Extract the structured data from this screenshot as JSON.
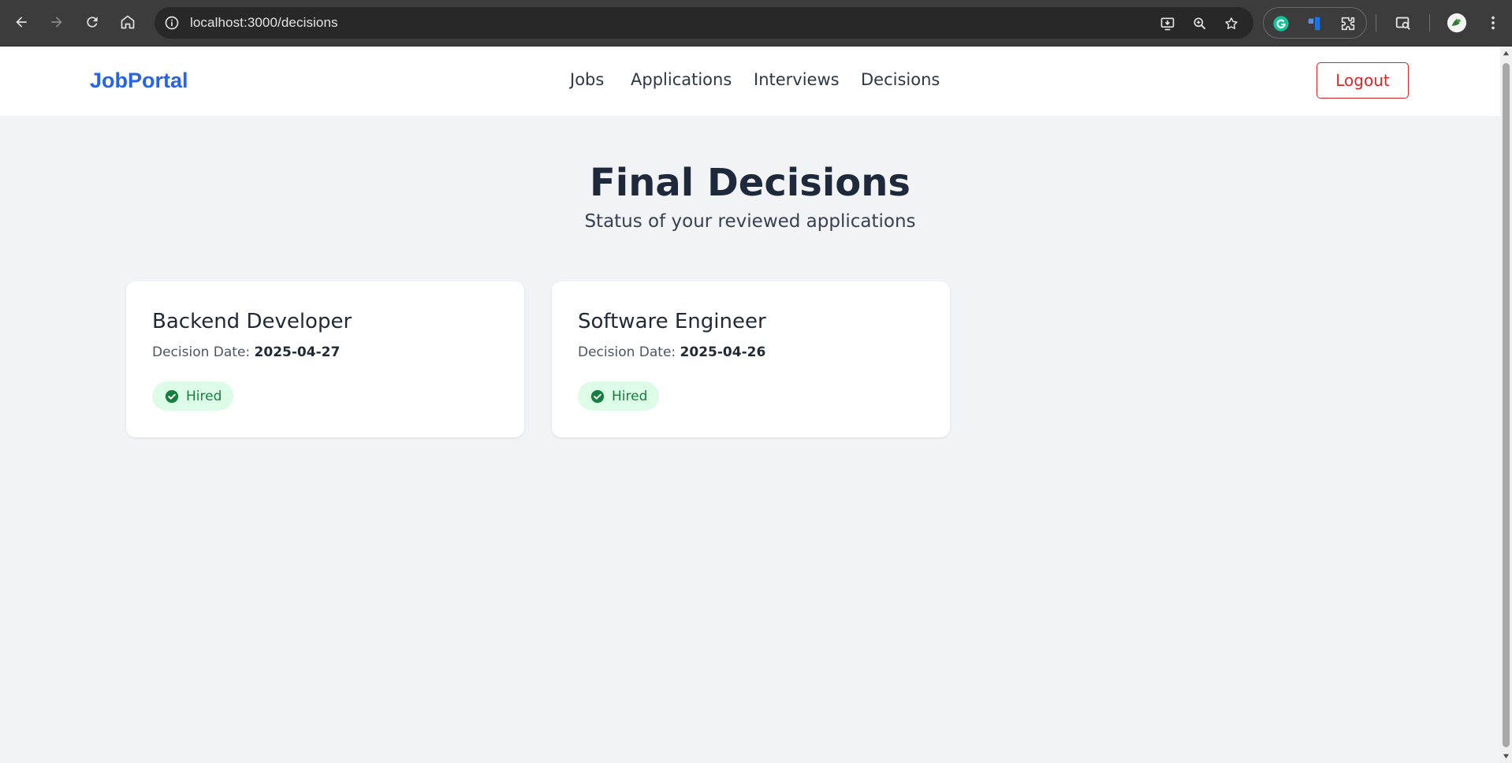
{
  "browser": {
    "url": "localhost:3000/decisions",
    "colors": {
      "chrome_bg": "#3c3c3c",
      "omnibox_bg": "#282828"
    }
  },
  "header": {
    "brand": "JobPortal",
    "nav": [
      "Jobs",
      "Applications",
      "Interviews",
      "Decisions"
    ],
    "logout_label": "Logout"
  },
  "main": {
    "title": "Final Decisions",
    "subtitle": "Status of your reviewed applications",
    "date_label": "Decision Date:",
    "cards": [
      {
        "job_title": "Backend Developer",
        "decision_date": "2025-04-27",
        "status": "Hired"
      },
      {
        "job_title": "Software Engineer",
        "decision_date": "2025-04-26",
        "status": "Hired"
      }
    ]
  },
  "colors": {
    "brand": "#2563eb",
    "logout": "#dc2626",
    "badge_bg": "#dcfce7",
    "badge_text": "#15803d",
    "page_bg": "#f2f3f5"
  }
}
